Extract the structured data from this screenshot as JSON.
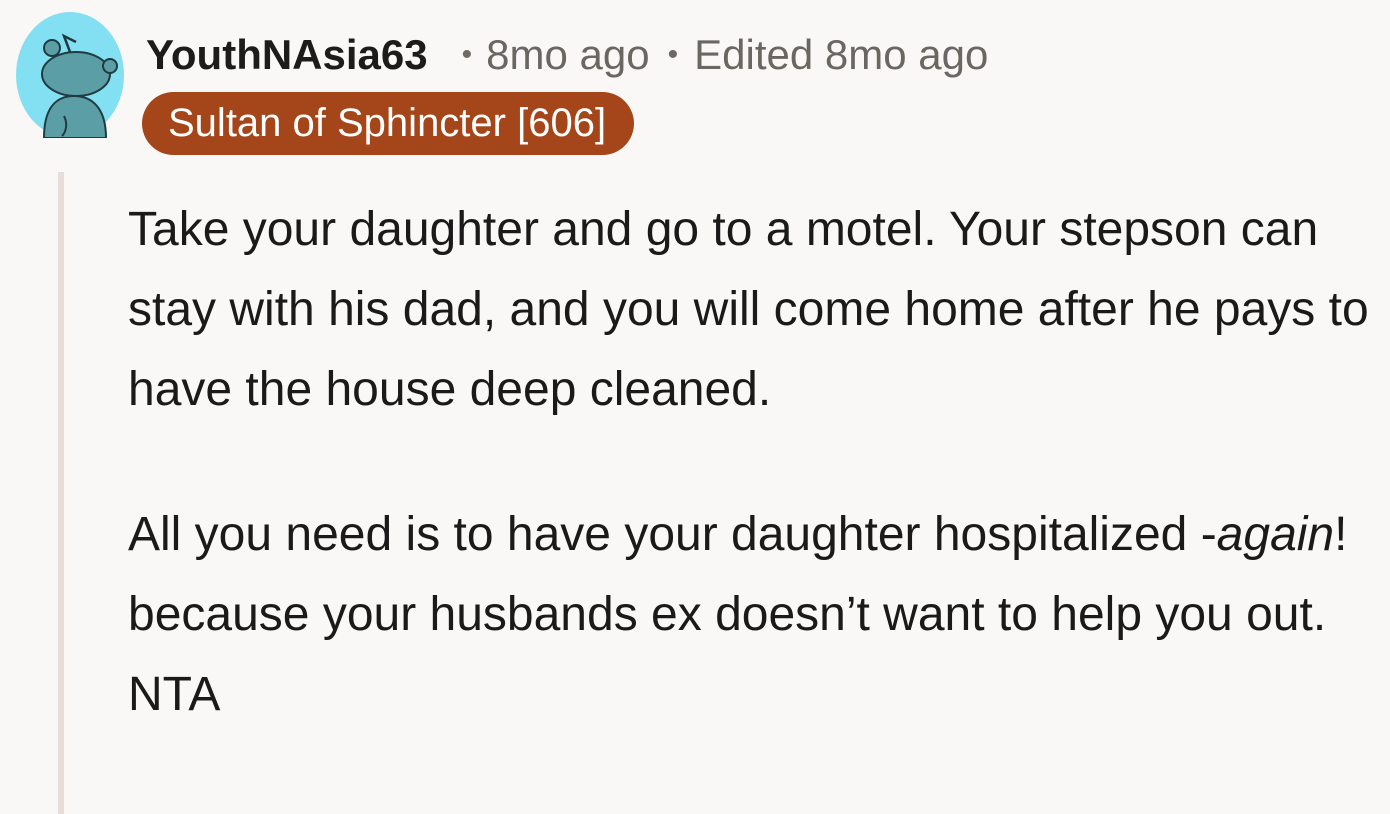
{
  "comment": {
    "username": "YouthNAsia63",
    "separator": "•",
    "age": "8mo ago",
    "edited": "Edited 8mo ago",
    "flair": "Sultan of Sphincter [606]",
    "avatar_icon": "snoo-avatar-icon",
    "colors": {
      "flair_bg": "#a5451a",
      "avatar_bg": "#83e0f2",
      "avatar_body": "#5c9ea6",
      "thread_line": "#e6dfd9"
    },
    "paragraph1": "Take your daughter and go to a motel. Your stepson can stay with his dad, and you will come home after he pays to have the house deep cleaned.",
    "paragraph2": {
      "before": "All you need is to have your daughter hospitalized -",
      "emphasis": "again",
      "after": "! because your husbands ex doesn’t want to help you out. NTA"
    }
  }
}
